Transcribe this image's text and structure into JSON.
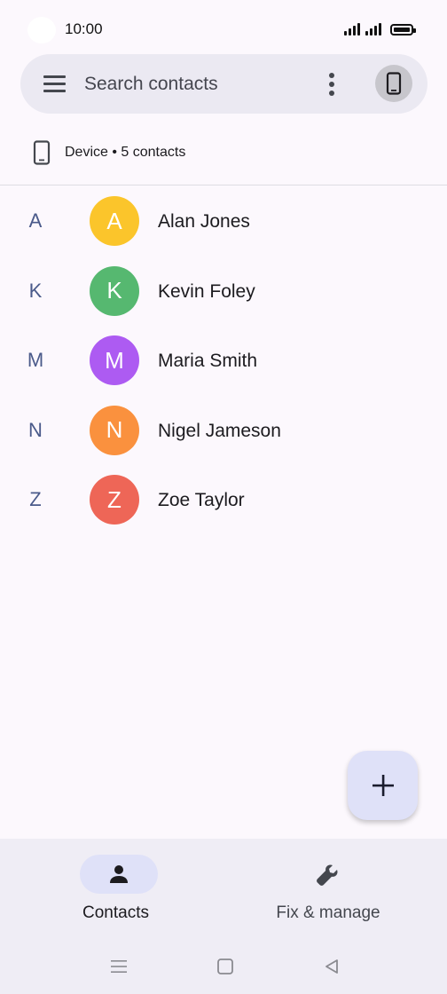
{
  "status_bar": {
    "time": "10:00"
  },
  "search": {
    "placeholder": "Search contacts"
  },
  "source": {
    "label": "Device • 5 contacts"
  },
  "contacts": [
    {
      "letter": "A",
      "initial": "A",
      "name": "Alan Jones",
      "color": "#fbc52b"
    },
    {
      "letter": "K",
      "initial": "K",
      "name": "Kevin Foley",
      "color": "#56b870"
    },
    {
      "letter": "M",
      "initial": "M",
      "name": "Maria Smith",
      "color": "#ad5bf2"
    },
    {
      "letter": "N",
      "initial": "N",
      "name": "Nigel Jameson",
      "color": "#fa913e"
    },
    {
      "letter": "Z",
      "initial": "Z",
      "name": "Zoe Taylor",
      "color": "#ee6657"
    }
  ],
  "bottom_nav": {
    "contacts_label": "Contacts",
    "fix_label": "Fix & manage"
  },
  "icons": {
    "menu": "menu-icon",
    "more": "more-vert-icon",
    "account": "phone-icon",
    "source": "phone-icon",
    "fab": "plus-icon",
    "contacts_tab": "person-icon",
    "fix_tab": "wrench-icon",
    "sys_recents": "hamburger-lines-icon",
    "sys_home": "square-icon",
    "sys_back": "triangle-back-icon"
  },
  "colors": {
    "background": "#fcf8fd",
    "search_bar": "#ebe9f2",
    "accent_container": "#dfe1f8",
    "letter": "#4a5a8a"
  }
}
